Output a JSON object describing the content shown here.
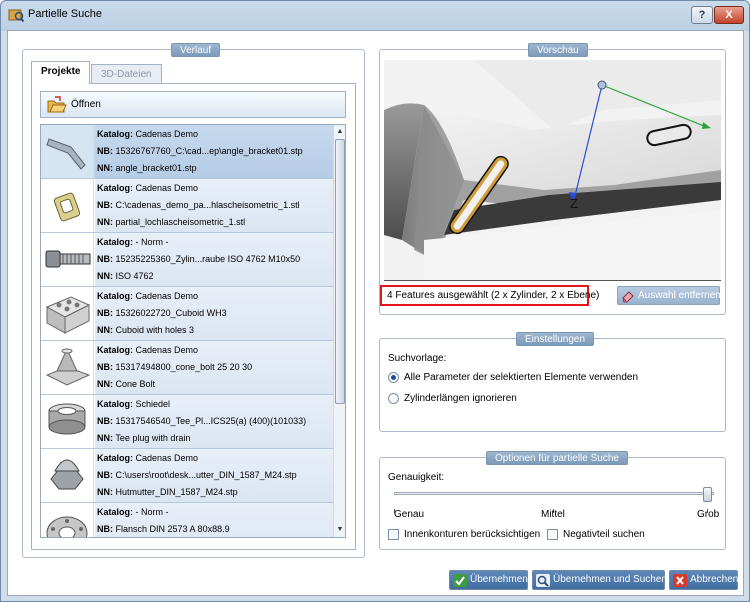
{
  "window": {
    "title": "Partielle Suche",
    "help_label": "?",
    "close_label": "X"
  },
  "left_panel": {
    "group_title": "Verlauf",
    "tabs": [
      {
        "label": "Projekte"
      },
      {
        "label": "3D-Dateien"
      }
    ],
    "open_button": "Öffnen",
    "items": [
      {
        "thumb": "angle-bracket-thumbnail",
        "k_label": "Katalog:",
        "k": "Cadenas Demo",
        "nb_label": "NB:",
        "nb": "15326767760_C:\\cad...ep\\angle_bracket01.stp",
        "nn_label": "NN:",
        "nn": "angle_bracket01.stp",
        "selected": true
      },
      {
        "thumb": "plate-with-slot-thumbnail",
        "k_label": "Katalog:",
        "k": "Cadenas Demo",
        "nb_label": "NB:",
        "nb": "C:\\cadenas_demo_pa...hlascheisometric_1.stl",
        "nn_label": "NN:",
        "nn": "partial_lochlascheisometric_1.stl"
      },
      {
        "thumb": "cylinder-screw-thumbnail",
        "k_label": "Katalog:",
        "k": "- Norm -",
        "nb_label": "NB:",
        "nb": "15235225360_Zylin...raube ISO 4762 M10x50",
        "nn_label": "NN:",
        "nn": "ISO 4762"
      },
      {
        "thumb": "cuboid-with-holes-thumbnail",
        "k_label": "Katalog:",
        "k": "Cadenas Demo",
        "nb_label": "NB:",
        "nb": "15326022720_Cuboid WH3",
        "nn_label": "NN:",
        "nn": "Cuboid with holes 3"
      },
      {
        "thumb": "cone-bolt-thumbnail",
        "k_label": "Katalog:",
        "k": "Cadenas Demo",
        "nb_label": "NB:",
        "nb": "15317494800_cone_bolt 25 20 30",
        "nn_label": "NN:",
        "nn": "Cone Bolt"
      },
      {
        "thumb": "tee-plug-thumbnail",
        "k_label": "Katalog:",
        "k": "Schiedel",
        "nb_label": "NB:",
        "nb": "15317546540_Tee_Pl...ICS25(a) (400)(101033)",
        "nn_label": "NN:",
        "nn": "Tee plug with drain"
      },
      {
        "thumb": "cap-nut-thumbnail",
        "k_label": "Katalog:",
        "k": "Cadenas Demo",
        "nb_label": "NB:",
        "nb": "C:\\users\\root\\desk...utter_DIN_1587_M24.stp",
        "nn_label": "NN:",
        "nn": "Hutmutter_DIN_1587_M24.stp"
      },
      {
        "thumb": "flange-thumbnail",
        "k_label": "Katalog:",
        "k": "- Norm -",
        "nb_label": "NB:",
        "nb": "Flansch DIN 2573 A 80x88.9",
        "nn_label": "NN:",
        "nn": ""
      }
    ]
  },
  "preview": {
    "group_title": "Vorschau",
    "axis_label": "Z",
    "selection_status": "4 Features ausgewählt (2 x Zylinder, 2 x Ebene)",
    "clear_button": "Auswahl entfernen"
  },
  "settings": {
    "group_title": "Einstellungen",
    "template_label": "Suchvorlage:",
    "option_all": "Alle Parameter der selektierten Elemente verwenden",
    "option_ignore": "Zylinderlängen ignorieren",
    "selected_option": "option_all"
  },
  "options": {
    "group_title": "Optionen für partielle Suche",
    "accuracy_label": "Genauigkeit:",
    "slider_labels": [
      "Genau",
      "Mittel",
      "Grob"
    ],
    "slider_value": "Grob",
    "inner_contours": "Innenkonturen berücksichtigen",
    "negative_part": "Negativteil suchen",
    "inner_contours_checked": false,
    "negative_part_checked": false
  },
  "footer": {
    "apply": "Übernehmen",
    "apply_search": "Übernehmen und Suchen",
    "cancel": "Abbrechen"
  },
  "colors": {
    "title_bar": "#bcd0e4",
    "group_title": "#8aa6c4",
    "highlight_red": "#e3161b",
    "footer_button": "#4d7aad"
  }
}
